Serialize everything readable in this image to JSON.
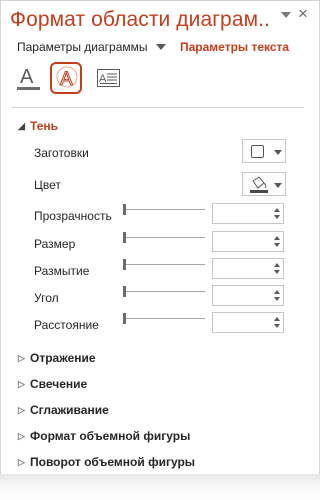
{
  "pane": {
    "title": "Формат области диаграм...",
    "title_dropdown_icon": "chevron-down-icon",
    "close_label": "×"
  },
  "tabs": {
    "chart_options": "Параметры диаграммы",
    "text_options": "Параметры текста"
  },
  "icons": {
    "text_fill": "text-fill-outline-icon",
    "text_effects": "text-effects-icon",
    "text_box": "text-box-icon",
    "selected": "text-effects"
  },
  "shadow": {
    "header": "Тень",
    "expanded_marker": "◢",
    "presets_label": "Заготовки",
    "color_label": "Цвет",
    "transparency_label": "Прозрачность",
    "size_label": "Размер",
    "blur_label": "Размытие",
    "angle_label": "Угол",
    "distance_label": "Расстояние",
    "transparency_value": "",
    "size_value": "",
    "blur_value": "",
    "angle_value": "",
    "distance_value": "",
    "slider_levels": {
      "transparency": 0,
      "size": 0,
      "blur": 0,
      "angle": 0,
      "distance": 0
    }
  },
  "sections": {
    "collapsed_marker": "▷",
    "reflection": "Отражение",
    "glow": "Свечение",
    "soft_edges": "Сглаживание",
    "format_3d": "Формат объемной фигуры",
    "rotation_3d": "Поворот объемной фигуры"
  },
  "colors": {
    "accent": "#c43e1c",
    "text": "#262626",
    "border": "#c6c6c6"
  }
}
